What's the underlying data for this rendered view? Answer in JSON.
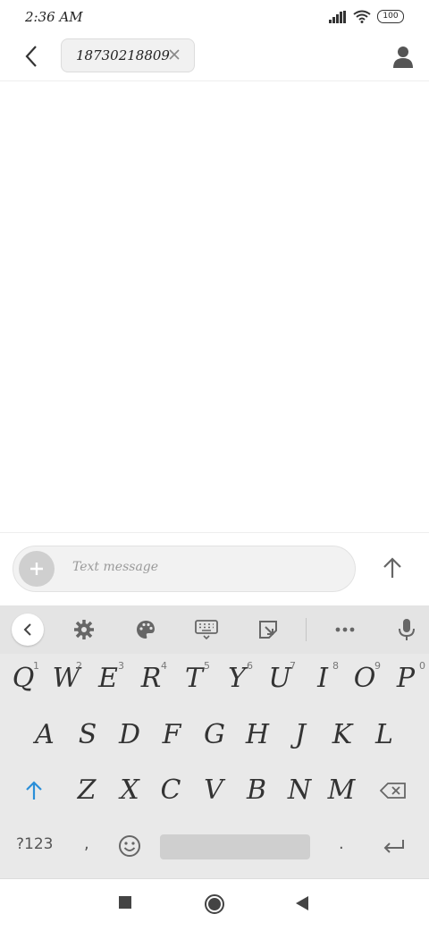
{
  "status": {
    "time": "2:36 AM",
    "battery": "100"
  },
  "header": {
    "recipient": "18730218809"
  },
  "compose": {
    "placeholder": "Text message"
  },
  "keyboard": {
    "row1": [
      {
        "key": "Q",
        "num": "1"
      },
      {
        "key": "W",
        "num": "2"
      },
      {
        "key": "E",
        "num": "3"
      },
      {
        "key": "R",
        "num": "4"
      },
      {
        "key": "T",
        "num": "5"
      },
      {
        "key": "Y",
        "num": "6"
      },
      {
        "key": "U",
        "num": "7"
      },
      {
        "key": "I",
        "num": "8"
      },
      {
        "key": "O",
        "num": "9"
      },
      {
        "key": "P",
        "num": "0"
      }
    ],
    "row2": [
      "A",
      "S",
      "D",
      "F",
      "G",
      "H",
      "J",
      "K",
      "L"
    ],
    "row3": [
      "Z",
      "X",
      "C",
      "V",
      "B",
      "N",
      "M"
    ],
    "symbols_label": "?123",
    "comma": ",",
    "period": "."
  }
}
